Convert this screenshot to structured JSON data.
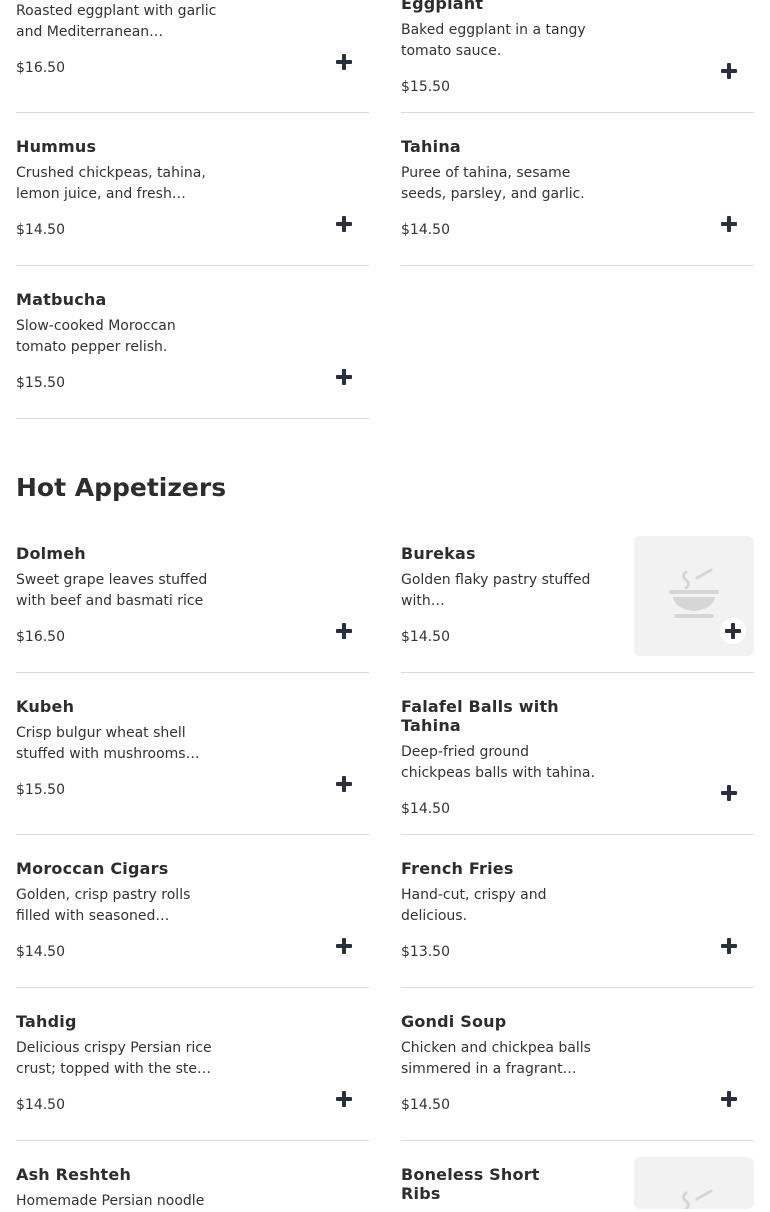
{
  "sections": [
    {
      "title": "Hot Appetizers"
    }
  ],
  "items": {
    "roasted_eggplant": {
      "desc": "Roasted eggplant with garlic and Mediterranean…",
      "price": "$16.50"
    },
    "eggplant": {
      "name": "Eggplant",
      "desc": "Baked eggplant in a tangy tomato sauce.",
      "price": "$15.50"
    },
    "hummus": {
      "name": "Hummus",
      "desc": "Crushed chickpeas, tahina, lemon juice, and fresh…",
      "price": "$14.50"
    },
    "tahina": {
      "name": "Tahina",
      "desc": "Puree of tahina, sesame seeds, parsley, and garlic.",
      "price": "$14.50"
    },
    "matbucha": {
      "name": "Matbucha",
      "desc": "Slow-cooked Moroccan tomato pepper relish.",
      "price": "$15.50"
    },
    "dolmeh": {
      "name": "Dolmeh",
      "desc": "Sweet grape leaves stuffed with beef and basmati rice",
      "price": "$16.50"
    },
    "burekas": {
      "name": "Burekas",
      "desc": "Golden flaky pastry stuffed with…",
      "price": "$14.50"
    },
    "kubeh": {
      "name": "Kubeh",
      "desc": "Crisp bulgur wheat shell stuffed with mushrooms…",
      "price": "$15.50"
    },
    "falafel": {
      "name": "Falafel Balls with Tahina",
      "desc": "Deep-fried ground chickpeas balls with tahina.",
      "price": "$14.50"
    },
    "moroccan_cigars": {
      "name": "Moroccan Cigars",
      "desc": "Golden, crisp pastry rolls filled with seasoned…",
      "price": "$14.50"
    },
    "french_fries": {
      "name": "French Fries",
      "desc": "Hand-cut, crispy and delicious.",
      "price": "$13.50"
    },
    "tahdig": {
      "name": "Tahdig",
      "desc": "Delicious crispy Persian rice crust; topped with the ste…",
      "price": "$14.50"
    },
    "gondi_soup": {
      "name": "Gondi Soup",
      "desc": "Chicken and chickpea balls simmered in a fragrant…",
      "price": "$14.50"
    },
    "ash_reshteh": {
      "name": "Ash Reshteh",
      "desc": "Homemade Persian noodle"
    },
    "boneless_short_ribs": {
      "name": "Boneless Short Ribs"
    }
  },
  "icons": {
    "add": "plus-icon",
    "placeholder": "bowl-icon"
  },
  "colors": {
    "text": "#2d2d2d",
    "icon": "#2b2f3b",
    "divider": "#dcdcdc",
    "thumb_bg": "#f2f2f2"
  }
}
